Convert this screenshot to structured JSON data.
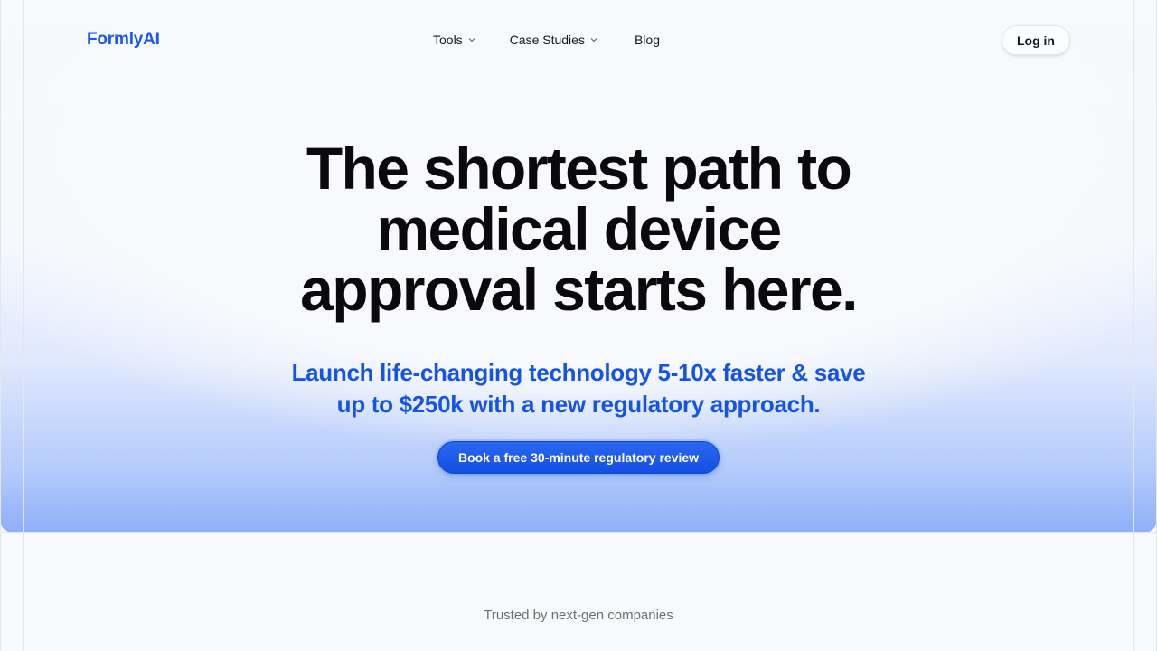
{
  "brand": {
    "name": "FormlyAI",
    "accent": "#1857e8"
  },
  "nav": {
    "items": [
      {
        "label": "Tools",
        "icon": "chevron-down-icon"
      },
      {
        "label": "Case Studies",
        "icon": "chevron-down-icon"
      },
      {
        "label": "Blog"
      }
    ],
    "login_label": "Log in"
  },
  "hero": {
    "headline_lines": [
      "The shortest path to",
      "medical device",
      "approval starts here."
    ],
    "subhead_lines": [
      "Launch life-changing technology 5-10x faster & save",
      "up to $250k with a new regulatory approach."
    ],
    "cta_label": "Book a free 30-minute regulatory review"
  },
  "trusted": {
    "label": "Trusted by next-gen companies"
  },
  "colors": {
    "headline": "#0a0a0d",
    "subhead": "#1453e6",
    "cta": "#1a5ae9",
    "background": "#f7f9fc"
  }
}
